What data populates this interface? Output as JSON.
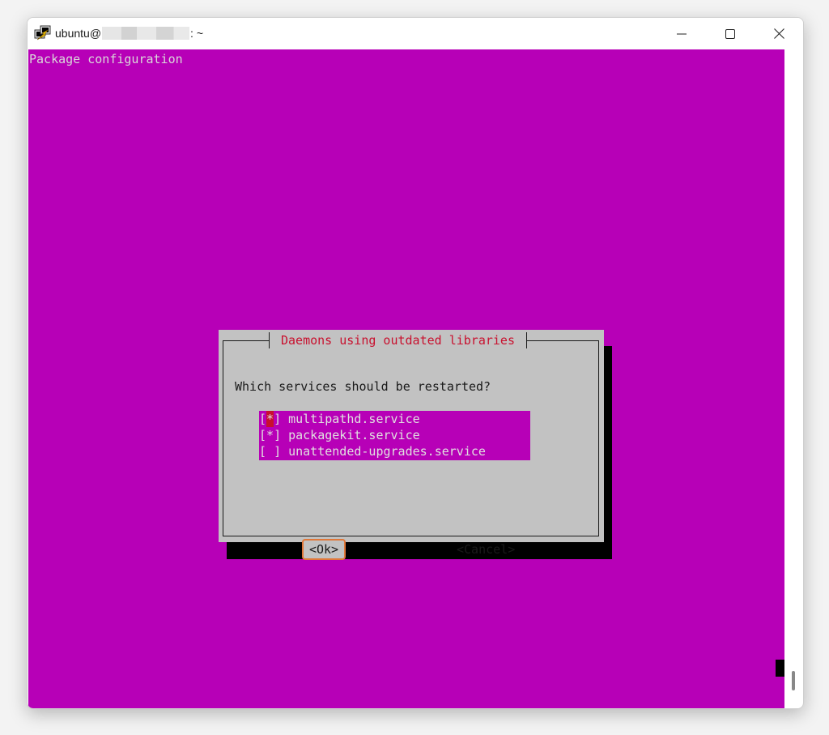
{
  "window": {
    "title_prefix": "ubuntu@",
    "title_suffix": ": ~",
    "colors": {
      "terminal_bg": "#b700b7",
      "dialog_bg": "#c2c2c2",
      "accent": "#c8102e"
    }
  },
  "terminal": {
    "header": "Package configuration"
  },
  "dialog": {
    "title": "Daemons using outdated libraries",
    "prompt": "Which services should be restarted?",
    "items": [
      {
        "bracket_open": "[",
        "mark": "*",
        "bracket_close": "]",
        "label": "multipathd.service"
      },
      {
        "bracket_open": "[",
        "mark": "*",
        "bracket_close": "]",
        "label": "packagekit.service"
      },
      {
        "bracket_open": "[",
        "mark": " ",
        "bracket_close": "]",
        "label": "unattended-upgrades.service"
      }
    ],
    "ok_label": "<Ok>",
    "cancel_label": "<Cancel>"
  }
}
